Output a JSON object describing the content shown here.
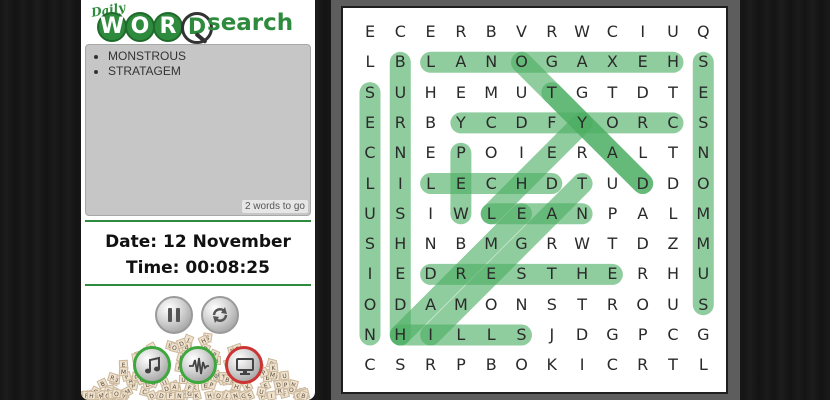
{
  "logo": {
    "daily": "Daily",
    "word_letters": [
      "W",
      "O",
      "R",
      "D"
    ],
    "search": "search"
  },
  "words_remaining": [
    "MONSTROUS",
    "STRATAGEM"
  ],
  "words_to_go": "2 words to go",
  "date_line": "Date: 12 November",
  "time_line": "Time: 00:08:25",
  "controls": [
    {
      "name": "pause-button",
      "icon": "pause-icon",
      "accent": "#9a9a9a"
    },
    {
      "name": "restart-button",
      "icon": "refresh-icon",
      "accent": "#9a9a9a"
    },
    {
      "name": "music-button",
      "icon": "music-note-icon",
      "accent": "#3da83d"
    },
    {
      "name": "sound-button",
      "icon": "waveform-icon",
      "accent": "#3da83d"
    },
    {
      "name": "fullscreen-button",
      "icon": "monitor-icon",
      "accent": "#cc3333"
    }
  ],
  "colors": {
    "brand_green": "#2e8b3d",
    "highlight": "#4caf63"
  },
  "grid": [
    "ECERBVRWCIUQ",
    "LBLANOGAXEHS",
    "SUHEMUTGTDTE",
    "ERBYCDFYORCS",
    "CNEPOIERALTN",
    "LILECHDTUDDO",
    "USIWLEANPALM",
    "SHNBMGRWTDZM",
    "IEDRESTHERHU",
    "ODAMONSTROUS",
    "NHILLSJDGPCG",
    "CSRPBOKICRTL"
  ],
  "found_words": [
    {
      "start": [
        1,
        2
      ],
      "end": [
        1,
        10
      ]
    },
    {
      "start": [
        1,
        5
      ],
      "end": [
        5,
        9
      ]
    },
    {
      "start": [
        2,
        6
      ],
      "end": [
        5,
        9
      ]
    },
    {
      "start": [
        3,
        3
      ],
      "end": [
        3,
        10
      ]
    },
    {
      "start": [
        1,
        11
      ],
      "end": [
        9,
        11
      ]
    },
    {
      "start": [
        2,
        0
      ],
      "end": [
        10,
        0
      ]
    },
    {
      "start": [
        1,
        1
      ],
      "end": [
        10,
        1
      ]
    },
    {
      "start": [
        3,
        7
      ],
      "end": [
        6,
        4
      ]
    },
    {
      "start": [
        5,
        2
      ],
      "end": [
        5,
        6
      ]
    },
    {
      "start": [
        4,
        3
      ],
      "end": [
        6,
        3
      ]
    },
    {
      "start": [
        6,
        4
      ],
      "end": [
        6,
        7
      ]
    },
    {
      "start": [
        8,
        2
      ],
      "end": [
        8,
        8
      ]
    },
    {
      "start": [
        10,
        1
      ],
      "end": [
        10,
        5
      ]
    },
    {
      "start": [
        5,
        7
      ],
      "end": [
        10,
        2
      ]
    },
    {
      "start": [
        6,
        5
      ],
      "end": [
        10,
        1
      ]
    }
  ]
}
